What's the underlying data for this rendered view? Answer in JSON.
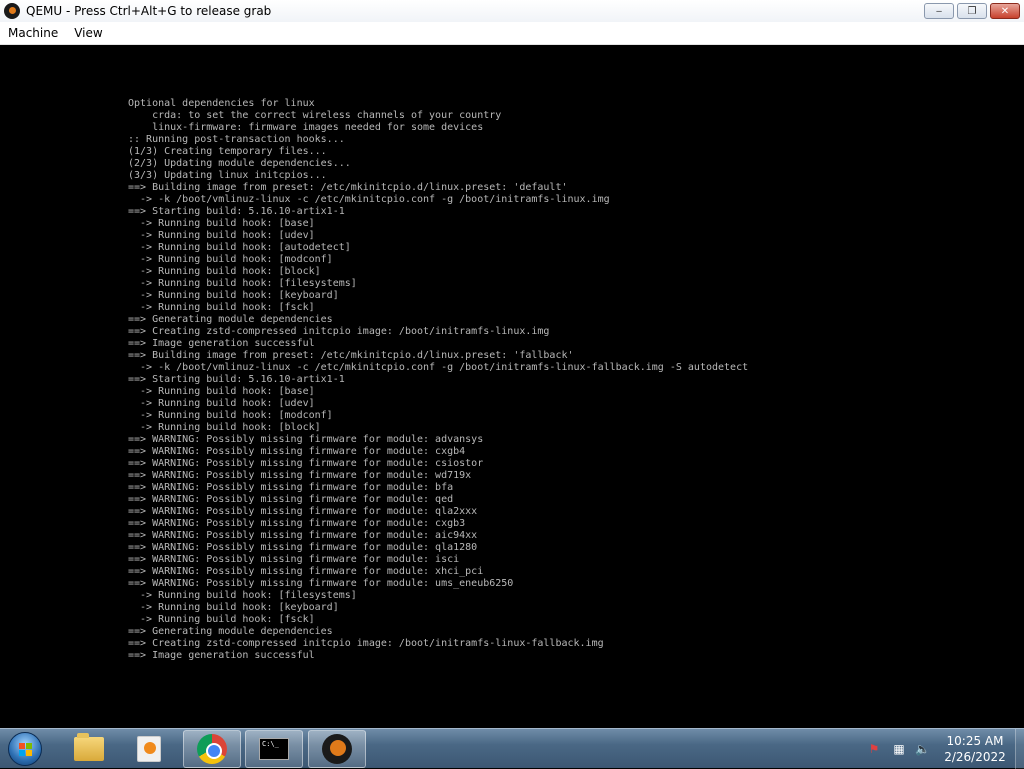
{
  "window": {
    "title": "QEMU - Press Ctrl+Alt+G to release grab",
    "minimize_glyph": "‒",
    "maximize_glyph": "❐",
    "close_glyph": "✕"
  },
  "menubar": {
    "items": [
      "Machine",
      "View"
    ]
  },
  "console_lines": [
    "Optional dependencies for linux",
    "    crda: to set the correct wireless channels of your country",
    "    linux-firmware: firmware images needed for some devices",
    ":: Running post-transaction hooks...",
    "(1/3) Creating temporary files...",
    "(2/3) Updating module dependencies...",
    "(3/3) Updating linux initcpios...",
    "==> Building image from preset: /etc/mkinitcpio.d/linux.preset: 'default'",
    "  -> -k /boot/vmlinuz-linux -c /etc/mkinitcpio.conf -g /boot/initramfs-linux.img",
    "==> Starting build: 5.16.10-artix1-1",
    "  -> Running build hook: [base]",
    "  -> Running build hook: [udev]",
    "  -> Running build hook: [autodetect]",
    "  -> Running build hook: [modconf]",
    "  -> Running build hook: [block]",
    "  -> Running build hook: [filesystems]",
    "  -> Running build hook: [keyboard]",
    "  -> Running build hook: [fsck]",
    "==> Generating module dependencies",
    "==> Creating zstd-compressed initcpio image: /boot/initramfs-linux.img",
    "==> Image generation successful",
    "==> Building image from preset: /etc/mkinitcpio.d/linux.preset: 'fallback'",
    "  -> -k /boot/vmlinuz-linux -c /etc/mkinitcpio.conf -g /boot/initramfs-linux-fallback.img -S autodetect",
    "==> Starting build: 5.16.10-artix1-1",
    "  -> Running build hook: [base]",
    "  -> Running build hook: [udev]",
    "  -> Running build hook: [modconf]",
    "  -> Running build hook: [block]",
    "==> WARNING: Possibly missing firmware for module: advansys",
    "==> WARNING: Possibly missing firmware for module: cxgb4",
    "==> WARNING: Possibly missing firmware for module: csiostor",
    "==> WARNING: Possibly missing firmware for module: wd719x",
    "==> WARNING: Possibly missing firmware for module: bfa",
    "==> WARNING: Possibly missing firmware for module: qed",
    "==> WARNING: Possibly missing firmware for module: qla2xxx",
    "==> WARNING: Possibly missing firmware for module: cxgb3",
    "==> WARNING: Possibly missing firmware for module: aic94xx",
    "==> WARNING: Possibly missing firmware for module: qla1280",
    "==> WARNING: Possibly missing firmware for module: isci",
    "==> WARNING: Possibly missing firmware for module: xhci_pci",
    "==> WARNING: Possibly missing firmware for module: ums_eneub6250",
    "  -> Running build hook: [filesystems]",
    "  -> Running build hook: [keyboard]",
    "  -> Running build hook: [fsck]",
    "==> Generating module dependencies",
    "==> Creating zstd-compressed initcpio image: /boot/initramfs-linux-fallback.img",
    "==> Image generation successful"
  ],
  "taskbar": {
    "cmd_icon_text": "C:\\_",
    "clock_time": "10:25 AM",
    "clock_date": "2/26/2022",
    "tray": {
      "flag_glyph": "⚑",
      "network_glyph": "▦",
      "volume_glyph": "🔈"
    }
  },
  "colors": {
    "console_text": "#b8b8b8",
    "console_bg": "#000000",
    "taskbar_bg": "#4a6885"
  }
}
